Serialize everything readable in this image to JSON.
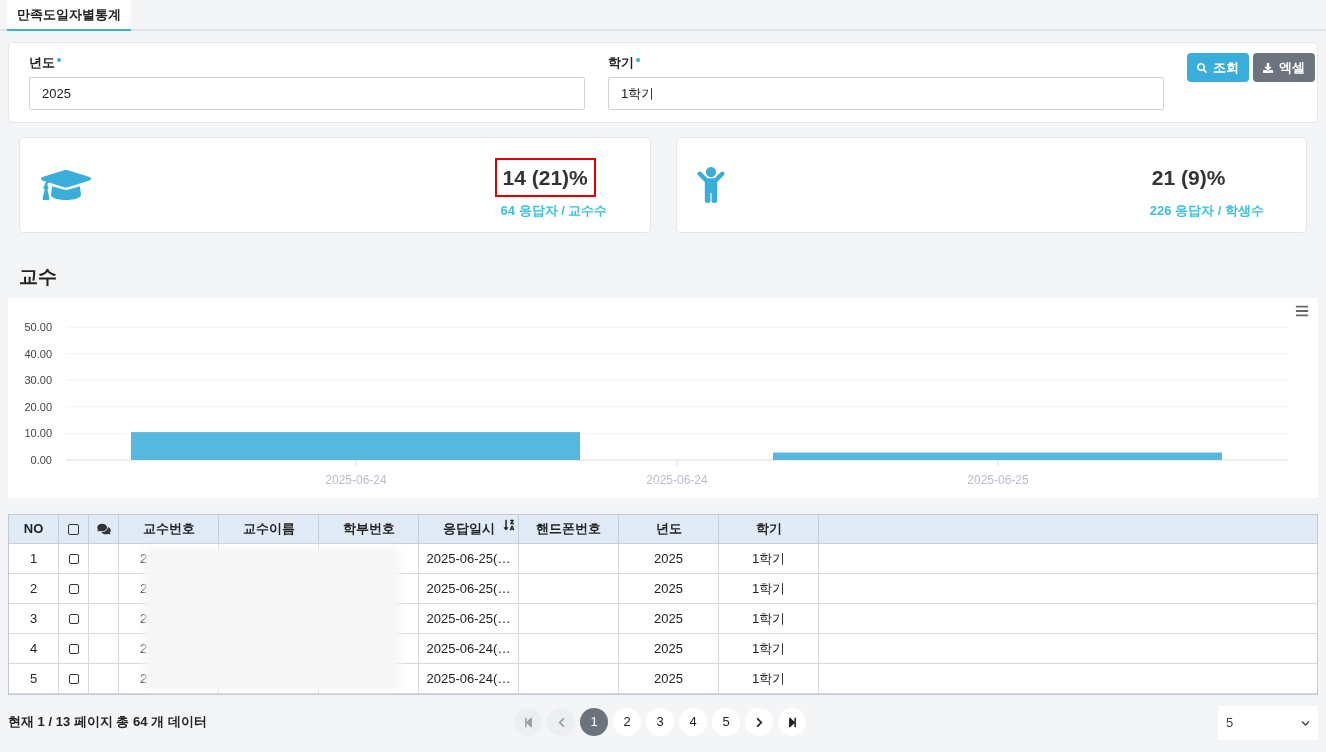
{
  "tabs": [
    {
      "label": "만족도일자별통계",
      "selected": true
    }
  ],
  "filters": [
    {
      "label": "년도",
      "required": true,
      "value": "2025"
    },
    {
      "label": "학기",
      "required": true,
      "value": "1학기"
    }
  ],
  "buttons": [
    {
      "label": "조회",
      "kind": "search"
    },
    {
      "label": "엑셀",
      "kind": "download"
    }
  ],
  "stats": [
    {
      "kind": "professor",
      "value": "14 (21)%",
      "highlighted": true,
      "caption": "64 응답자 / 교수수"
    },
    {
      "kind": "student",
      "value": "21 (9)%",
      "highlighted": false,
      "caption": "226 응답자 / 학생수"
    }
  ],
  "section_title": "교수",
  "chart": {
    "chart_data": {
      "type": "bar",
      "categories": [
        "2025-06-24",
        "2025-06-24",
        "2025-06-25"
      ],
      "series": [
        {
          "color": "#56b8df",
          "values": [
            10.5,
            0,
            2.8
          ]
        }
      ],
      "ylim": [
        0,
        50
      ],
      "grid": true,
      "yticks": [
        {
          "value": 0,
          "label": "0.00"
        },
        {
          "value": 10,
          "label": "10.00"
        },
        {
          "value": 20,
          "label": "20.00"
        },
        {
          "value": 30,
          "label": "30.00"
        },
        {
          "value": 40,
          "label": "40.00"
        },
        {
          "value": 50,
          "label": "50.00"
        }
      ]
    }
  },
  "table": {
    "columns": [
      {
        "label": "NO",
        "kind": "text"
      },
      {
        "kind": "checkbox",
        "checked": false
      },
      {
        "kind": "comment"
      },
      {
        "label": "교수번호",
        "kind": "text"
      },
      {
        "label": "교수이름",
        "kind": "text"
      },
      {
        "label": "학부번호",
        "kind": "text"
      },
      {
        "label": "응답일시",
        "kind": "sort"
      },
      {
        "label": "핸드폰번호",
        "kind": "text"
      },
      {
        "label": "년도",
        "kind": "text"
      },
      {
        "label": "학기",
        "kind": "text"
      }
    ],
    "rows": [
      {
        "no": "1",
        "checked": false,
        "professor_no": "2",
        "responded": "2025-06-25(…",
        "year": "2025",
        "term": "1학기"
      },
      {
        "no": "2",
        "checked": false,
        "professor_no": "2",
        "responded": "2025-06-25(…",
        "year": "2025",
        "term": "1학기"
      },
      {
        "no": "3",
        "checked": false,
        "professor_no": "2",
        "responded": "2025-06-25(…",
        "year": "2025",
        "term": "1학기"
      },
      {
        "no": "4",
        "checked": false,
        "professor_no": "2",
        "responded": "2025-06-24(…",
        "year": "2025",
        "term": "1학기"
      },
      {
        "no": "5",
        "checked": false,
        "professor_no": "2",
        "responded": "2025-06-24(…",
        "year": "2025",
        "term": "1학기"
      }
    ]
  },
  "footer": {
    "summary": "현재 1 / 13 페이지 총 64 개 데이터",
    "nav": [
      {
        "kind": "first",
        "disabled": true
      },
      {
        "kind": "prev",
        "disabled": true
      }
    ],
    "pages": [
      {
        "label": "1",
        "selected": true
      },
      {
        "label": "2",
        "selected": false
      },
      {
        "label": "3",
        "selected": false
      },
      {
        "label": "4",
        "selected": false
      },
      {
        "label": "5",
        "selected": false
      }
    ],
    "nav_end": [
      {
        "kind": "next",
        "disabled": false
      },
      {
        "kind": "last",
        "disabled": false
      }
    ],
    "page_size": "5"
  }
}
